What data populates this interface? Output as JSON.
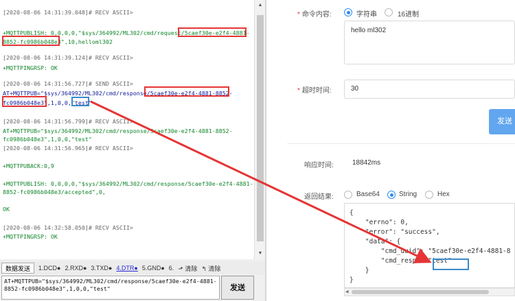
{
  "terminal": {
    "lines": [
      {
        "text": "[2020-08-06 14:31:39.048]# RECV ASCII>",
        "color": "gray"
      },
      {
        "text": "",
        "color": "gray"
      },
      {
        "text": "+MQTTPUBLISH: 0,0,0,0,\"$sys/364992/ML302/cmd/request/5caef30e-e2f4-4881-",
        "color": "green"
      },
      {
        "text": "8852-fc0986b048e3\",10,helloml302",
        "color": "green"
      },
      {
        "text": "[2020-08-06 14:31:39.124]# RECV ASCII>",
        "color": "gray"
      },
      {
        "text": "+MQTTPINGRSP: OK",
        "color": "green"
      },
      {
        "text": "",
        "color": "gray"
      },
      {
        "text": "[2020-08-06 14:31:56.727]# SEND ASCII>",
        "color": "gray"
      },
      {
        "text": "AT+MQTTPUB=\"$sys/364992/ML302/cmd/response/5caef30e-e2f4-4881-8852-",
        "color": "blue"
      },
      {
        "text": "fc0986b048e3\",1,0,0,\"test\"",
        "color": "blue"
      },
      {
        "text": "",
        "color": "gray"
      },
      {
        "text": "[2020-08-06 14:31:56.799]# RECV ASCII>",
        "color": "gray"
      },
      {
        "text": "AT+MQTTPUB=\"$sys/364992/ML302/cmd/response/5caef30e-e2f4-4881-8852-",
        "color": "green"
      },
      {
        "text": "fc0986b048e3\",1,0,0,\"test\"",
        "color": "green"
      },
      {
        "text": "[2020-08-06 14:31:56.965]# RECV ASCII>",
        "color": "gray"
      },
      {
        "text": "",
        "color": "gray"
      },
      {
        "text": "+MQTTPUBACK:0,9",
        "color": "green"
      },
      {
        "text": "",
        "color": "gray"
      },
      {
        "text": "+MQTTPUBLISH: 0,0,0,0,\"$sys/364992/ML302/cmd/response/5caef30e-e2f4-4881-",
        "color": "green"
      },
      {
        "text": "8852-fc0986b048e3/accepted\",0,",
        "color": "green"
      },
      {
        "text": "",
        "color": "gray"
      },
      {
        "text": "OK",
        "color": "green"
      },
      {
        "text": "",
        "color": "gray"
      },
      {
        "text": "[2020-08-06 14:32:58.050]# RECV ASCII>",
        "color": "gray"
      },
      {
        "text": "+MQTTPINGRSP: OK",
        "color": "green"
      }
    ]
  },
  "toolbar": {
    "tab_label": "数据发送",
    "pins": [
      "1.DCD●",
      "2.RXD●",
      "3.TXD●",
      "4.DTR●",
      "5.GND●",
      "6."
    ],
    "active_pin": "4.DTR●",
    "clear_label_1": "清除",
    "clear_label_2": "清除"
  },
  "send_box": {
    "value": "AT+MQTTPUB=\"$sys/364992/ML302/cmd/response/5caef30e-e2f4-4881-\n8852-fc0986b048e3\",1,0,0,\"test\"",
    "send_label": "发送"
  },
  "form": {
    "command_label": "命令内容:",
    "radio_string": "字符串",
    "radio_hex": "16进制",
    "command_value": "hello ml302",
    "timeout_label": "超时时间:",
    "timeout_value": "30",
    "send_button": "发送",
    "response_time_label": "响应时间:",
    "response_time_value": "18842ms",
    "result_label": "返回结果:",
    "result_radios": [
      "Base64",
      "String",
      "Hex"
    ],
    "result_selected": "String",
    "result_code": "{\n    \"errno\": 0,\n    \"error\": \"success\",\n    \"data\": {\n        \"cmd_uuid\": \"5caef30e-e2f4-4881-8\n        \"cmd_resp\": \"test\"\n    }\n}"
  },
  "colors": {
    "highlight_red": "#e53535",
    "highlight_blue": "#3a89c9",
    "primary": "#2d8cf0"
  }
}
